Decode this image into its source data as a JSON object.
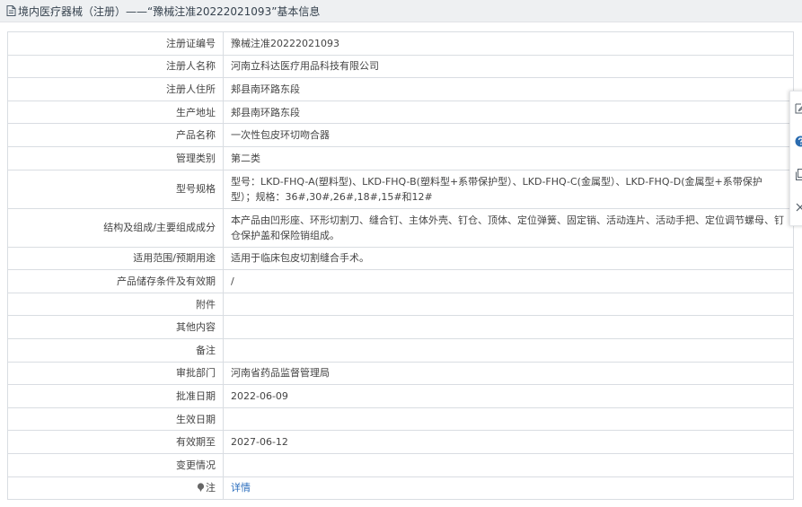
{
  "header": {
    "title": "境内医疗器械（注册）——“豫械注准20222021093”基本信息"
  },
  "rows": [
    {
      "label": "注册证编号",
      "value": "豫械注准20222021093"
    },
    {
      "label": "注册人名称",
      "value": "河南立科达医疗用品科技有限公司"
    },
    {
      "label": "注册人住所",
      "value": "郏县南环路东段"
    },
    {
      "label": "生产地址",
      "value": "郏县南环路东段"
    },
    {
      "label": "产品名称",
      "value": "一次性包皮环切吻合器"
    },
    {
      "label": "管理类别",
      "value": "第二类"
    },
    {
      "label": "型号规格",
      "value": "型号：LKD-FHQ-A(塑料型)、LKD-FHQ-B(塑料型+系带保护型）、LKD-FHQ-C(金属型）、LKD-FHQ-D(金属型+系带保护型）；规格：36#,30#,26#,18#,15#和12#"
    },
    {
      "label": "结构及组成/主要组成成分",
      "value": "本产品由凹形座、环形切割刀、缝合钉、主体外壳、钉仓、顶体、定位弹簧、固定销、活动连片、活动手把、定位调节螺母、钉仓保护盖和保险销组成。"
    },
    {
      "label": "适用范围/预期用途",
      "value": "适用于临床包皮切割缝合手术。"
    },
    {
      "label": "产品储存条件及有效期",
      "value": "/"
    },
    {
      "label": "附件",
      "value": ""
    },
    {
      "label": "其他内容",
      "value": ""
    },
    {
      "label": "备注",
      "value": ""
    },
    {
      "label": "审批部门",
      "value": "河南省药品监督管理局"
    },
    {
      "label": "批准日期",
      "value": "2022-06-09"
    },
    {
      "label": "生效日期",
      "value": ""
    },
    {
      "label": "有效期至",
      "value": "2027-06-12"
    },
    {
      "label": "变更情况",
      "value": ""
    },
    {
      "label": "注",
      "value": "详情"
    }
  ],
  "toolbar": {
    "icons": [
      "edit-icon",
      "help-icon",
      "copy-icon",
      "close-icon"
    ]
  },
  "colors": {
    "link": "#2a6dbd",
    "border": "#d9dde2",
    "header_bg": "#eef0f2",
    "help_icon": "#2b6cb0"
  }
}
